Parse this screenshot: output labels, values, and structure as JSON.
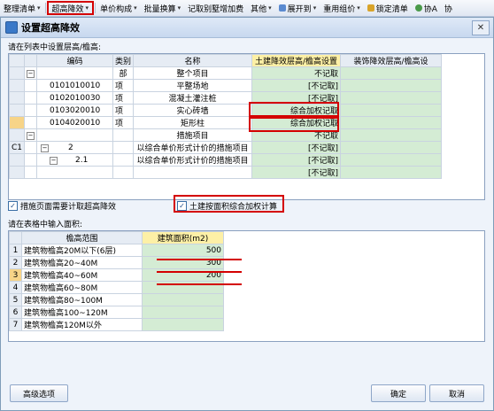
{
  "toolbar": {
    "items": [
      {
        "label": "整理清单"
      },
      {
        "label": "超高降效"
      },
      {
        "label": "单价构成"
      },
      {
        "label": "批量换算"
      },
      {
        "label": "记取别墅增加费"
      },
      {
        "label": "其他"
      },
      {
        "label": "展开到"
      },
      {
        "label": "重用组价"
      },
      {
        "label": "锁定清单"
      },
      {
        "label": "协A"
      },
      {
        "label": "协"
      }
    ]
  },
  "dialog": {
    "title": "设置超高降效",
    "list_label": "请在列表中设置层高/檐高:",
    "columns": [
      "编码",
      "类别",
      "名称",
      "土建降效层高/檐高设置",
      "装饰降效层高/檐高设"
    ],
    "rows": [
      {
        "code": "",
        "type": "部",
        "name": "整个项目",
        "setting": "不记取"
      },
      {
        "code": "0101010010",
        "type": "项",
        "name": "平整场地",
        "setting": "[不记取]"
      },
      {
        "code": "0102010030",
        "type": "项",
        "name": "混凝土灌注桩",
        "setting": "[不记取]"
      },
      {
        "code": "0103020010",
        "type": "项",
        "name": "实心砖墙",
        "setting": "综合加权记取"
      },
      {
        "code": "0104020010",
        "type": "项",
        "name": "矩形柱",
        "setting": "综合加权记取"
      },
      {
        "code": "",
        "type": "",
        "name": "措施项目",
        "setting": "不记取"
      },
      {
        "code": "2",
        "type": "",
        "name": "以综合单价形式计价的措施项目",
        "setting": "[不记取]",
        "rowlabel": "C1"
      },
      {
        "code": "2.1",
        "type": "",
        "name": "以综合单价形式计价的措施项目",
        "setting": "[不记取]"
      },
      {
        "code": "",
        "type": "",
        "name": "",
        "setting": "[不记取]"
      }
    ],
    "checkbox_measures": "措施页面需要计取超高降效",
    "checkbox_area": "土建按面积综合加权计算",
    "area_label": "请在表格中输入面积:",
    "area_columns": [
      "檐高范围",
      "建筑面积(m2)"
    ],
    "area_rows": [
      {
        "no": "1",
        "range": "建筑物檐高20M以下(6层)",
        "area": "500"
      },
      {
        "no": "2",
        "range": "建筑物檐高20~40M",
        "area": "300"
      },
      {
        "no": "3",
        "range": "建筑物檐高40~60M",
        "area": "200"
      },
      {
        "no": "4",
        "range": "建筑物檐高60~80M",
        "area": ""
      },
      {
        "no": "5",
        "range": "建筑物檐高80~100M",
        "area": ""
      },
      {
        "no": "6",
        "range": "建筑物檐高100~120M",
        "area": ""
      },
      {
        "no": "7",
        "range": "建筑物檐高120M以外",
        "area": ""
      }
    ],
    "advanced_button": "高级选项",
    "ok_button": "确定",
    "cancel_button": "取消",
    "close_glyph": "✕"
  },
  "colors": {
    "highlight_red": "#d40000",
    "green_cell": "#d4ecd4",
    "header_yellow": "#fdf0a6"
  }
}
